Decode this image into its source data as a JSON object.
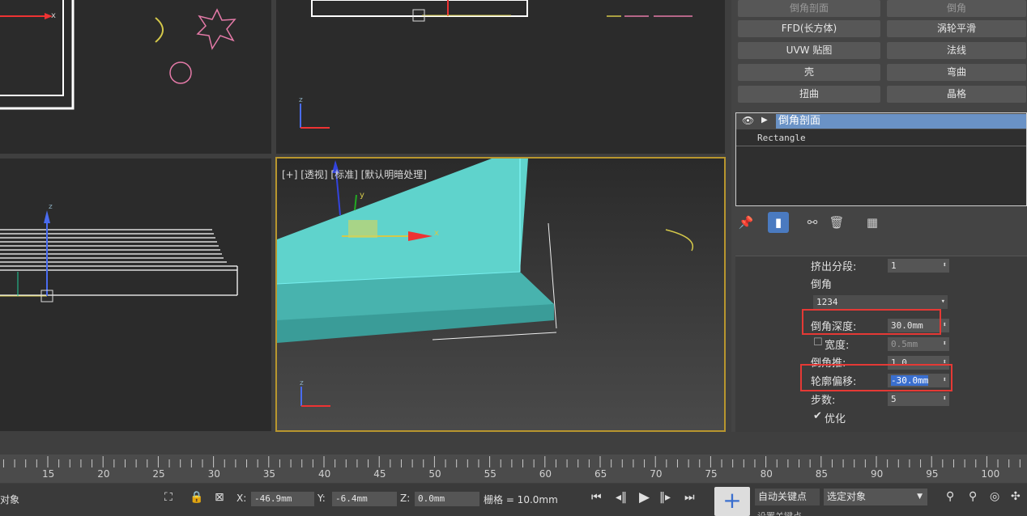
{
  "viewport_active": {
    "label": "[+] [透视] [标准] [默认明暗处理]"
  },
  "modifier_buttons": [
    {
      "label": "倒角剖面",
      "dim": true
    },
    {
      "label": "倒角",
      "dim": true
    },
    {
      "label": "FFD(长方体)"
    },
    {
      "label": "涡轮平滑"
    },
    {
      "label": "UVW 贴图"
    },
    {
      "label": "法线"
    },
    {
      "label": "壳"
    },
    {
      "label": "弯曲"
    },
    {
      "label": "扭曲"
    },
    {
      "label": "晶格"
    }
  ],
  "stack": {
    "selected": "倒角剖面",
    "sub": "Rectangle"
  },
  "params": {
    "extrude_segments": {
      "label": "挤出分段:",
      "value": "1"
    },
    "bevel_group": "倒角",
    "bevel_select": "1234",
    "bevel_depth": {
      "label": "倒角深度:",
      "value": "30.0mm"
    },
    "width": {
      "label": "宽度:",
      "value": "0.5mm"
    },
    "bevel_push": {
      "label": "倒角推:",
      "value": "1.0"
    },
    "contour_offset": {
      "label": "轮廓偏移:",
      "value": "-30.0mm"
    },
    "steps": {
      "label": "步数:",
      "value": "5"
    },
    "optimize": {
      "label": "优化",
      "checked": true
    }
  },
  "timeline": {
    "ticks": [
      "15",
      "20",
      "25",
      "30",
      "35",
      "40",
      "45",
      "50",
      "55",
      "60",
      "65",
      "70",
      "75",
      "80",
      "85",
      "90",
      "95",
      "100"
    ]
  },
  "status": {
    "left_text": "对象",
    "x_label": "X:",
    "x_value": "-46.9mm",
    "y_label": "Y:",
    "y_value": "-6.4mm",
    "z_label": "Z:",
    "z_value": "0.0mm",
    "grid_text": "栅格 = 10.0mm",
    "auto_key": "自动关键点",
    "selection": "选定对象",
    "set_key": "设置关键点"
  },
  "colors": {
    "accent": "#6a92c6",
    "highlight": "#e53935",
    "viewport_border": "#b8962e",
    "object": "#5fd3cc"
  }
}
